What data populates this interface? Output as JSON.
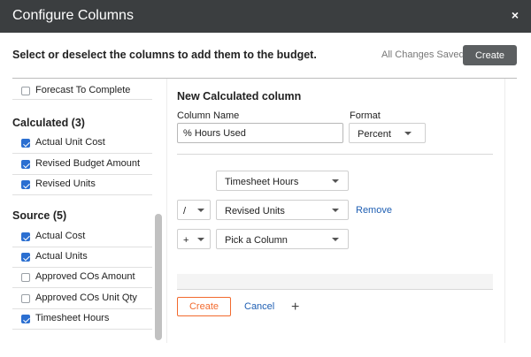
{
  "dialog": {
    "title": "Configure Columns",
    "close_icon": "×",
    "instruction": "Select or deselect the columns to add them to the budget.",
    "save_status": "All Changes Saved",
    "create_label": "Create"
  },
  "left": {
    "partial_item": "Forecast To Complete",
    "groups": [
      {
        "title": "Calculated (3)",
        "items": [
          {
            "label": "Actual Unit Cost",
            "checked": true
          },
          {
            "label": "Revised Budget Amount",
            "checked": true
          },
          {
            "label": "Revised Units",
            "checked": true
          }
        ]
      },
      {
        "title": "Source (5)",
        "items": [
          {
            "label": "Actual Cost",
            "checked": true
          },
          {
            "label": "Actual Units",
            "checked": true
          },
          {
            "label": "Approved COs Amount",
            "checked": false
          },
          {
            "label": "Approved COs Unit Qty",
            "checked": false
          },
          {
            "label": "Timesheet Hours",
            "checked": true
          }
        ]
      }
    ]
  },
  "form": {
    "title": "New Calculated column",
    "column_name_label": "Column Name",
    "column_name_value": "% Hours Used",
    "format_label": "Format",
    "format_value": "Percent",
    "rows": [
      {
        "operator": "",
        "column": "Timesheet Hours"
      },
      {
        "operator": "/",
        "column": "Revised Units"
      },
      {
        "operator": "+",
        "column": "Pick a Column"
      }
    ],
    "remove_label": "Remove",
    "create_label": "Create",
    "cancel_label": "Cancel",
    "add_label": "+"
  }
}
